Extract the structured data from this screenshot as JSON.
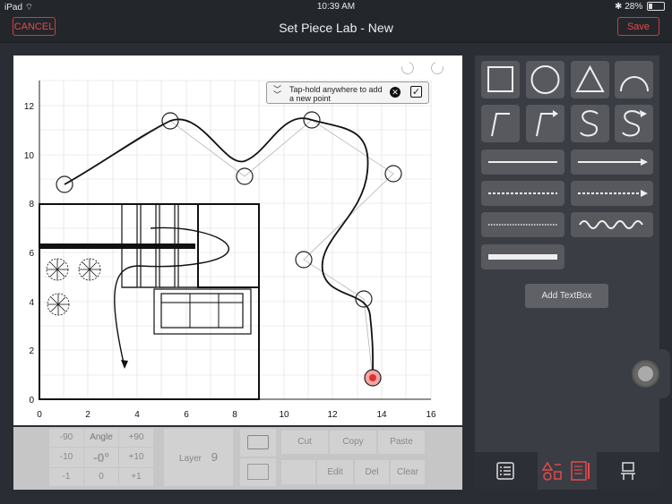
{
  "status_bar": {
    "device": "iPad",
    "time": "10:39 AM",
    "battery": "28%"
  },
  "nav": {
    "cancel_label": "CANCEL",
    "title": "Set Piece Lab - New",
    "save_label": "Save"
  },
  "tooltip": {
    "text": "Tap-hold anywhere to add a new point"
  },
  "axes": {
    "x_ticks": [
      "0",
      "2",
      "4",
      "6",
      "8",
      "10",
      "12",
      "14",
      "16"
    ],
    "y_ticks": [
      "0",
      "2",
      "4",
      "6",
      "8",
      "10",
      "12"
    ],
    "xlim": [
      0,
      16
    ],
    "ylim": [
      0,
      13
    ]
  },
  "control_panel": {
    "rotate_minus_90": "-90",
    "angle_label": "Angle",
    "rotate_plus_90": "+90",
    "rotate_minus_10": "-10",
    "angle_value": "-0°",
    "rotate_plus_10": "+10",
    "rotate_minus_1": "-1",
    "rotate_zero": "0",
    "rotate_plus_1": "+1",
    "layer_label": "Layer",
    "layer_value": "9",
    "cut_label": "Cut",
    "copy_label": "Copy",
    "paste_label": "Paste",
    "edit_label": "Edit",
    "del_label": "Del",
    "clear_label": "Clear"
  },
  "right_panel": {
    "add_textbox_label": "Add TextBox"
  },
  "colors": {
    "accent": "#d8393b",
    "panel": "#3a3d44",
    "background": "#2a2d33"
  }
}
